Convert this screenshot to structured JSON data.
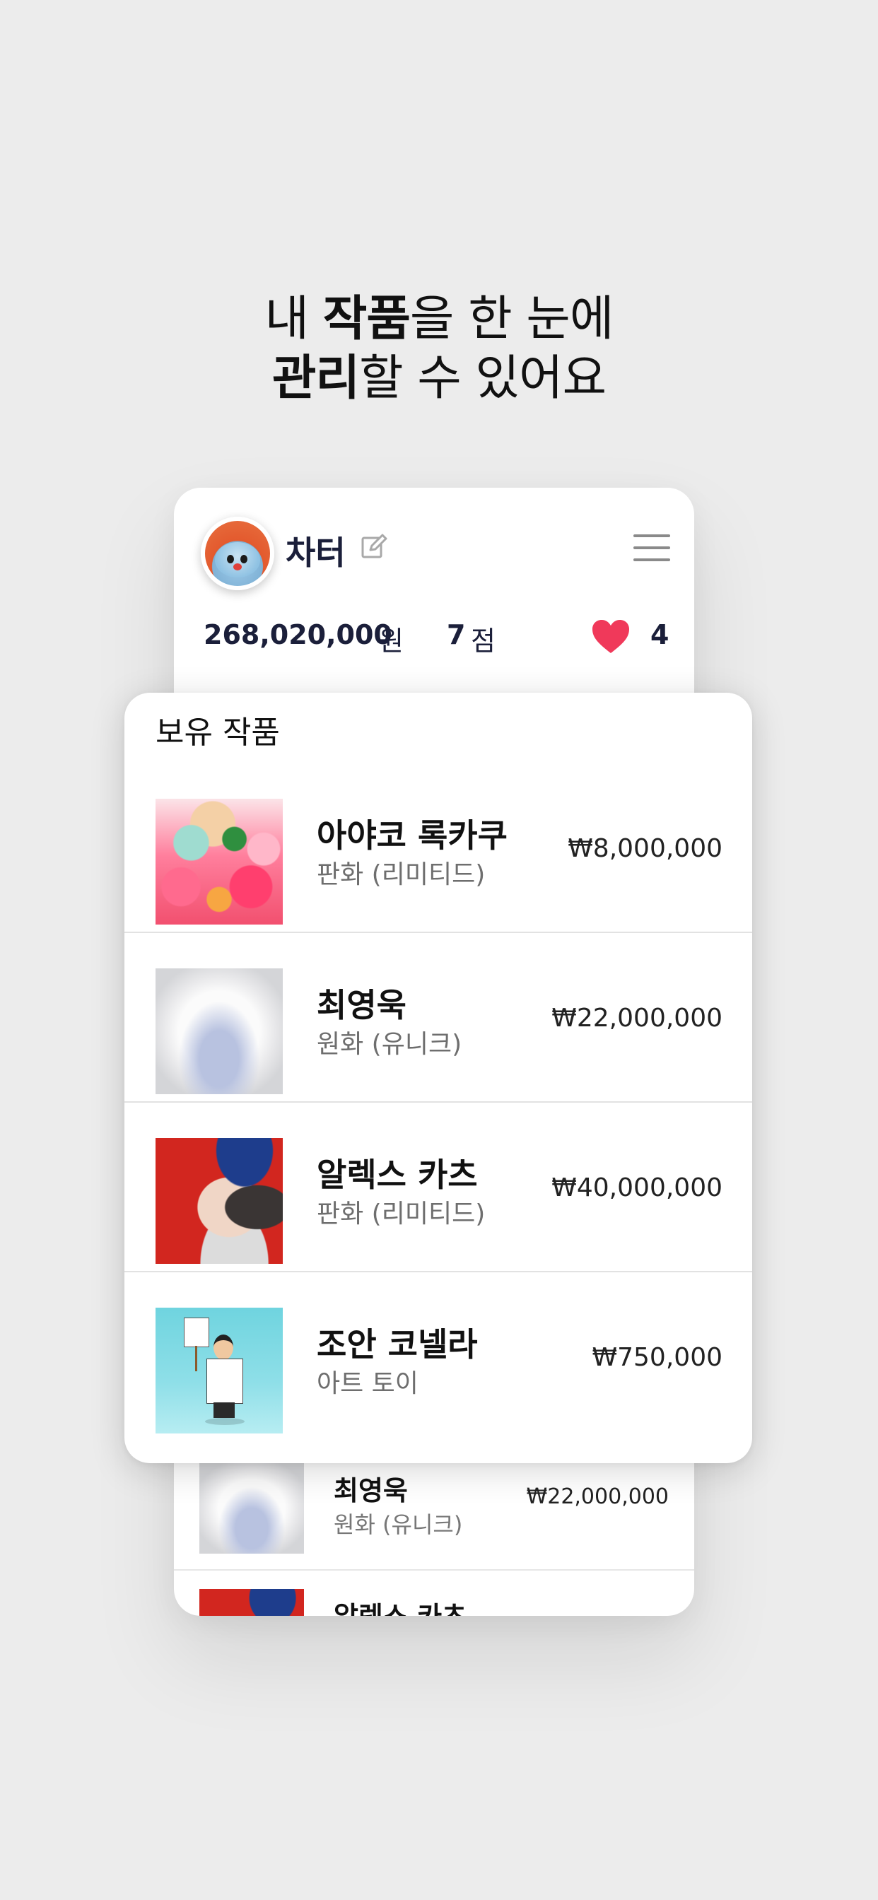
{
  "headline": {
    "line1_pre": "내 ",
    "line1_bold": "작품",
    "line1_post": "을 한 눈에",
    "line2_bold": "관리",
    "line2_post": "할 수 있어요"
  },
  "profile": {
    "username": "차터",
    "stats": {
      "amount": "268,020,000",
      "amount_unit": "원",
      "count": "7",
      "count_unit": "점",
      "likes": "4"
    },
    "icons": {
      "edit": "edit-icon",
      "menu": "menu-icon",
      "heart": "heart-icon"
    }
  },
  "owned": {
    "section_title": "보유 작품",
    "items": [
      {
        "artist": "아야코 록카쿠",
        "type": "판화 (리미티드)",
        "price": "₩8,000,000"
      },
      {
        "artist": "최영욱",
        "type": "원화 (유니크)",
        "price": "₩22,000,000"
      },
      {
        "artist": "알렉스 카츠",
        "type": "판화 (리미티드)",
        "price": "₩40,000,000"
      },
      {
        "artist": "조안 코넬라",
        "type": "아트 토이",
        "price": "₩750,000"
      }
    ]
  },
  "background_list": {
    "items": [
      {
        "artist": "최영욱",
        "type": "원화 (유니크)",
        "price": "₩22,000,000"
      },
      {
        "artist": "알렉스 카츠",
        "type": "",
        "price": ""
      }
    ]
  },
  "colors": {
    "background": "#ececec",
    "heart": "#f0395a",
    "text_navy": "#1b1f3a"
  }
}
